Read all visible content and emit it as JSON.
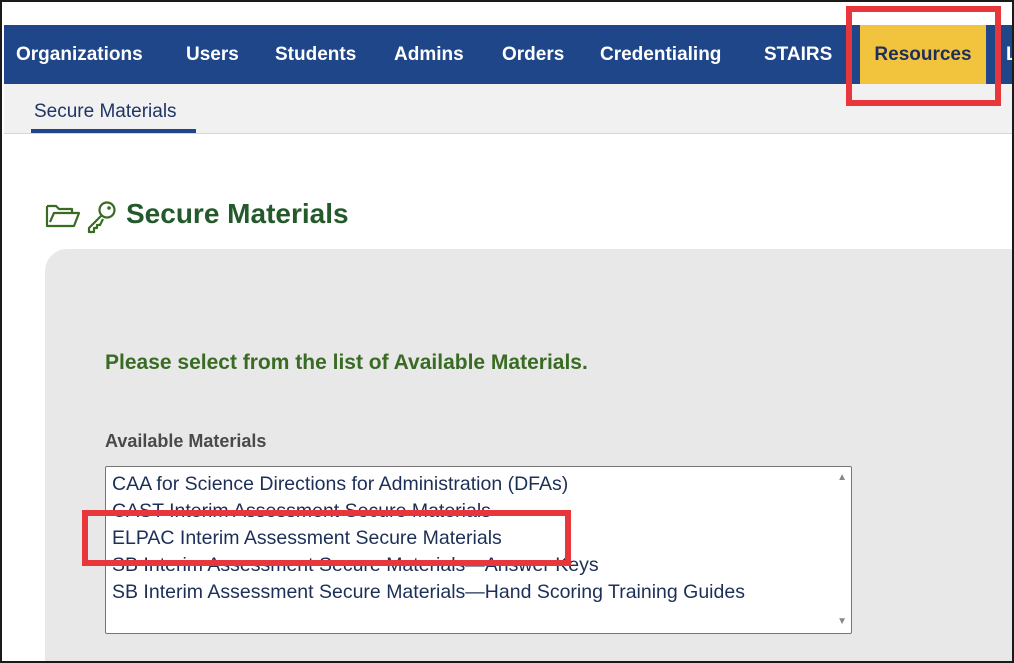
{
  "topnav": {
    "items": [
      {
        "label": "Organizations"
      },
      {
        "label": "Users"
      },
      {
        "label": "Students"
      },
      {
        "label": "Admins"
      },
      {
        "label": "Orders"
      },
      {
        "label": "Credentialing"
      },
      {
        "label": "STAIRS"
      },
      {
        "label": "Resources",
        "active": true
      },
      {
        "label": "L"
      }
    ],
    "colors": {
      "bar": "#1f4688",
      "active": "#f2c43d"
    }
  },
  "subnav": {
    "tab_label": "Secure Materials"
  },
  "page": {
    "title": "Secure Materials",
    "icons": [
      "folder-open-icon",
      "key-icon"
    ],
    "instruction": "Please select from the list of Available Materials.",
    "field_label": "Available Materials"
  },
  "materials": {
    "options": [
      "CAA for Science Directions for Administration (DFAs)",
      "CAST Interim Assessment Secure Materials",
      "ELPAC Interim Assessment Secure Materials",
      "SB Interim Assessment Secure Materials—Answer Keys",
      "SB Interim Assessment Secure Materials—Hand Scoring Training Guides"
    ],
    "highlighted_option": "ELPAC Interim Assessment Secure Materials"
  },
  "annotation_color": "#e8363d"
}
